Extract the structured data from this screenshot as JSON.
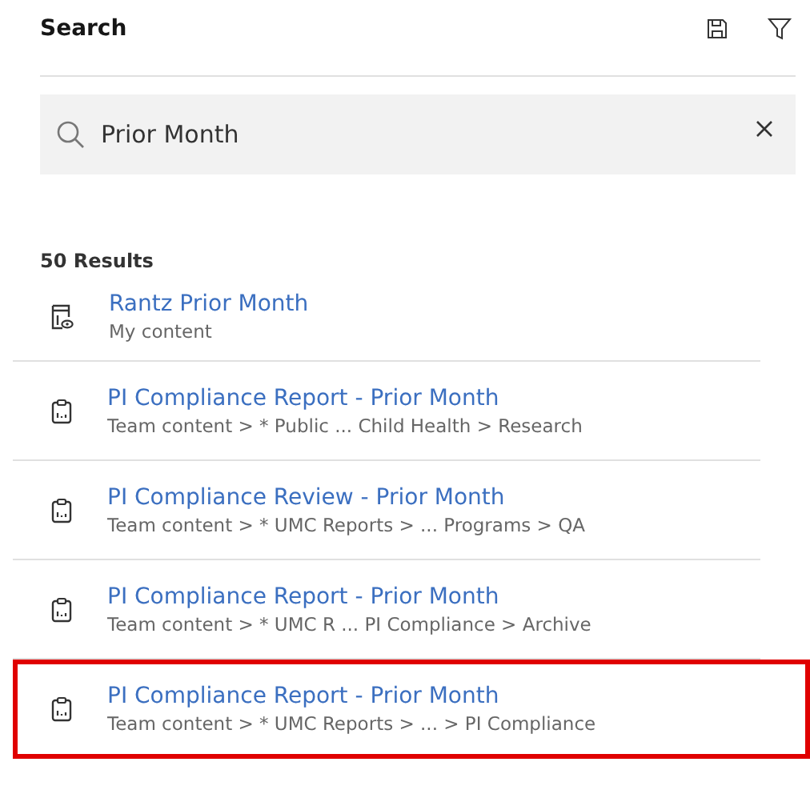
{
  "header": {
    "title": "Search"
  },
  "search": {
    "value": "Prior Month"
  },
  "results_count": "50 Results",
  "results": [
    {
      "kind": "view",
      "title": "Rantz Prior Month",
      "path": "My content",
      "highlighted": false
    },
    {
      "kind": "report",
      "title": "PI Compliance Report - Prior Month",
      "path": "Team content > * Public ... Child Health > Research",
      "highlighted": false
    },
    {
      "kind": "report",
      "title": "PI Compliance Review - Prior Month",
      "path": "Team content > * UMC Reports > ... Programs > QA",
      "highlighted": false
    },
    {
      "kind": "report",
      "title": "PI Compliance Report - Prior Month",
      "path": "Team content > * UMC R ... PI Compliance > Archive",
      "highlighted": false
    },
    {
      "kind": "report",
      "title": "PI Compliance Report - Prior Month",
      "path": "Team content > * UMC Reports > ... > PI Compliance",
      "highlighted": true
    }
  ]
}
